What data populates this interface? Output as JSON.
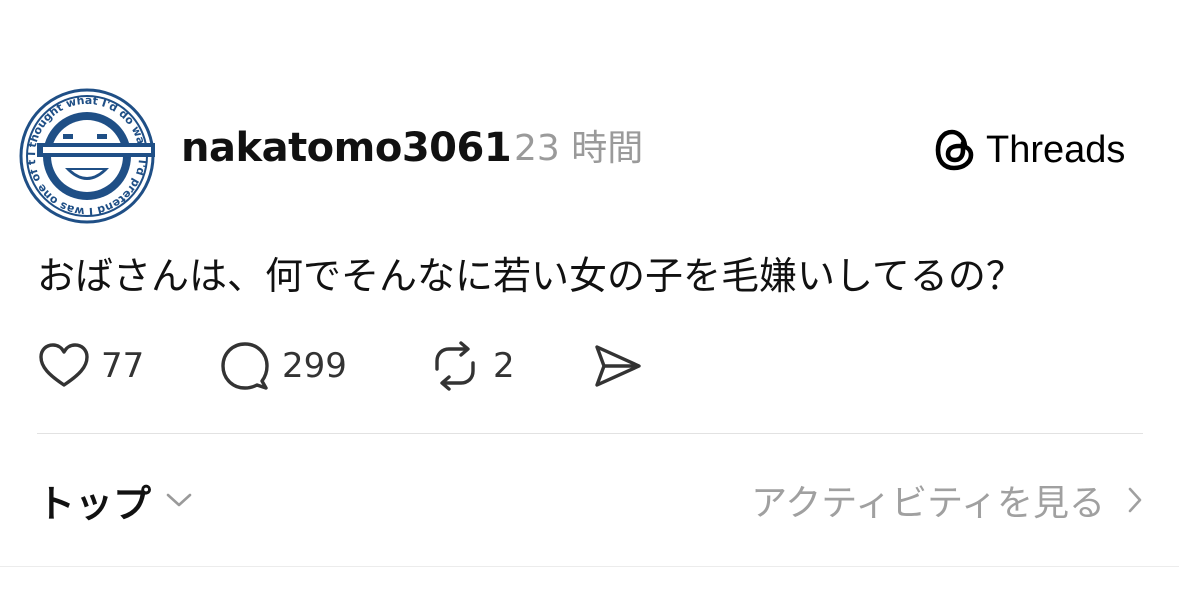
{
  "post": {
    "avatar": {
      "icon": "laughing-man-avatar",
      "ring_text": "I thought what I'd do was, I'd pretend I was one of those deaf-mutes"
    },
    "username": "nakatomo3061",
    "timestamp": "23 時間",
    "brand": {
      "icon": "threads-logo-icon",
      "label": "Threads"
    },
    "text": "おばさんは、何でそんなに若い女の子を毛嫌いしてるの？",
    "actions": {
      "like": {
        "icon": "heart-icon",
        "count": "77"
      },
      "reply": {
        "icon": "speech-bubble-icon",
        "count": "299"
      },
      "repost": {
        "icon": "repost-icon",
        "count": "2"
      },
      "share": {
        "icon": "send-icon"
      }
    }
  },
  "replies_bar": {
    "sort_label": "トップ",
    "sort_icon": "chevron-down-icon",
    "activity_label": "アクティビティを見る",
    "activity_icon": "chevron-right-icon"
  },
  "colors": {
    "text_primary": "#111111",
    "text_secondary": "#9a9a9a",
    "avatar_blue": "#1f4f86",
    "divider": "#e2e2e2"
  }
}
